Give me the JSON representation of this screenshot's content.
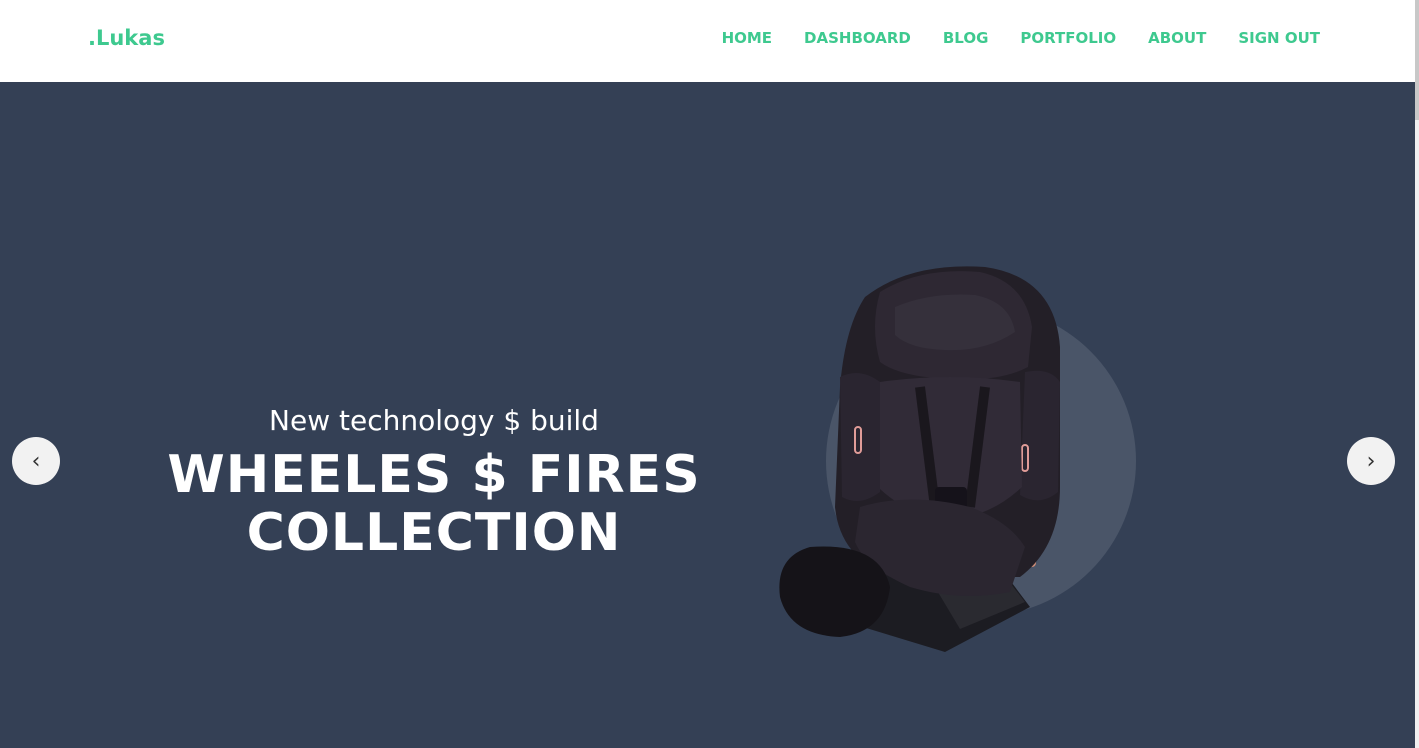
{
  "brand": {
    "logo_text": ".Lukas",
    "accent_color": "#3ec98f"
  },
  "nav": {
    "items": [
      {
        "label": "HOME"
      },
      {
        "label": "DASHBOARD"
      },
      {
        "label": "BLOG"
      },
      {
        "label": "PORTFOLIO"
      },
      {
        "label": "ABOUT"
      },
      {
        "label": "SIGN OUT"
      }
    ]
  },
  "hero": {
    "subtitle": "New technology $ build",
    "title_line1": "WHEELES $ FIRES",
    "title_line2": "COLLECTION",
    "background_color": "#344055",
    "product_image": "car-seat-image",
    "prev_icon": "chevron-left-icon",
    "next_icon": "chevron-right-icon",
    "prev_glyph": "‹",
    "next_glyph": "›"
  }
}
